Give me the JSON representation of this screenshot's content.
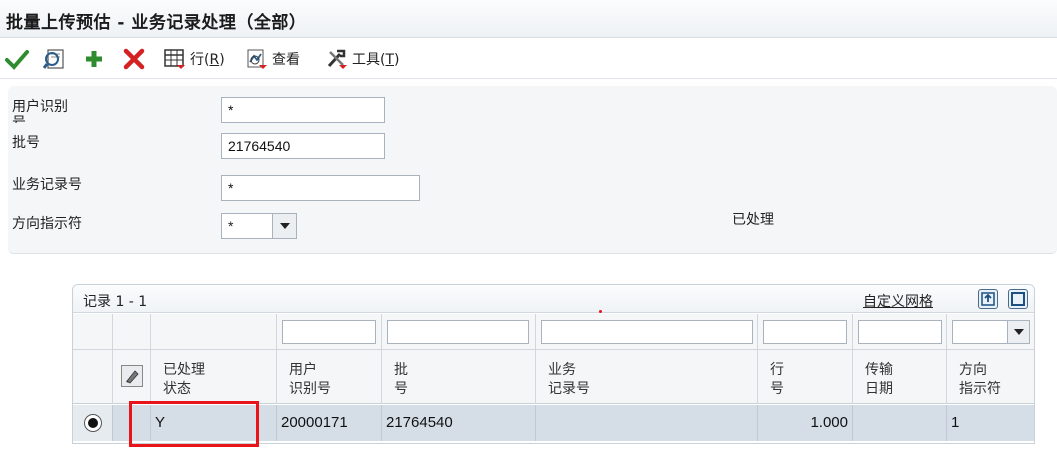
{
  "window": {
    "title": "批量上传预估 - 业务记录处理（全部）"
  },
  "toolbar": {
    "select_icon": "checkmark-icon",
    "find_icon": "find-icon",
    "add_icon": "plus-icon",
    "delete_icon": "x-icon",
    "row_label": "行(",
    "row_key": "R",
    "row_close": ")",
    "view_label": "查看",
    "tools_label": "工具(",
    "tools_key": "T",
    "tools_close": ")"
  },
  "form": {
    "user_id_label_1": "用户识别",
    "user_id_label_2": "号",
    "user_id_value": "*",
    "batch_label": "批号",
    "batch_value": "21764540",
    "txn_label": "业务记录号",
    "txn_value": "*",
    "direction_label": "方向指示符",
    "direction_value": "*",
    "processed_label": "已处理"
  },
  "grid": {
    "record_count": "记录 1 - 1",
    "customize_link": "自定义网格",
    "columns": [
      {
        "l1": "已处理",
        "l2": "状态"
      },
      {
        "l1": "用户",
        "l2": "识别号"
      },
      {
        "l1": "批",
        "l2": "号"
      },
      {
        "l1": "业务",
        "l2": "记录号"
      },
      {
        "l1": "行",
        "l2": "号"
      },
      {
        "l1": "传输",
        "l2": "日期"
      },
      {
        "l1": "方向",
        "l2": "指示符"
      }
    ],
    "rows": [
      {
        "processed": "Y",
        "user_id": "20000171",
        "batch": "21764540",
        "txn": "",
        "line": "1.000",
        "date": "",
        "direction": "1"
      }
    ]
  },
  "colors": {
    "accent_red": "#e8141a",
    "selected_row": "#d5dee7"
  }
}
